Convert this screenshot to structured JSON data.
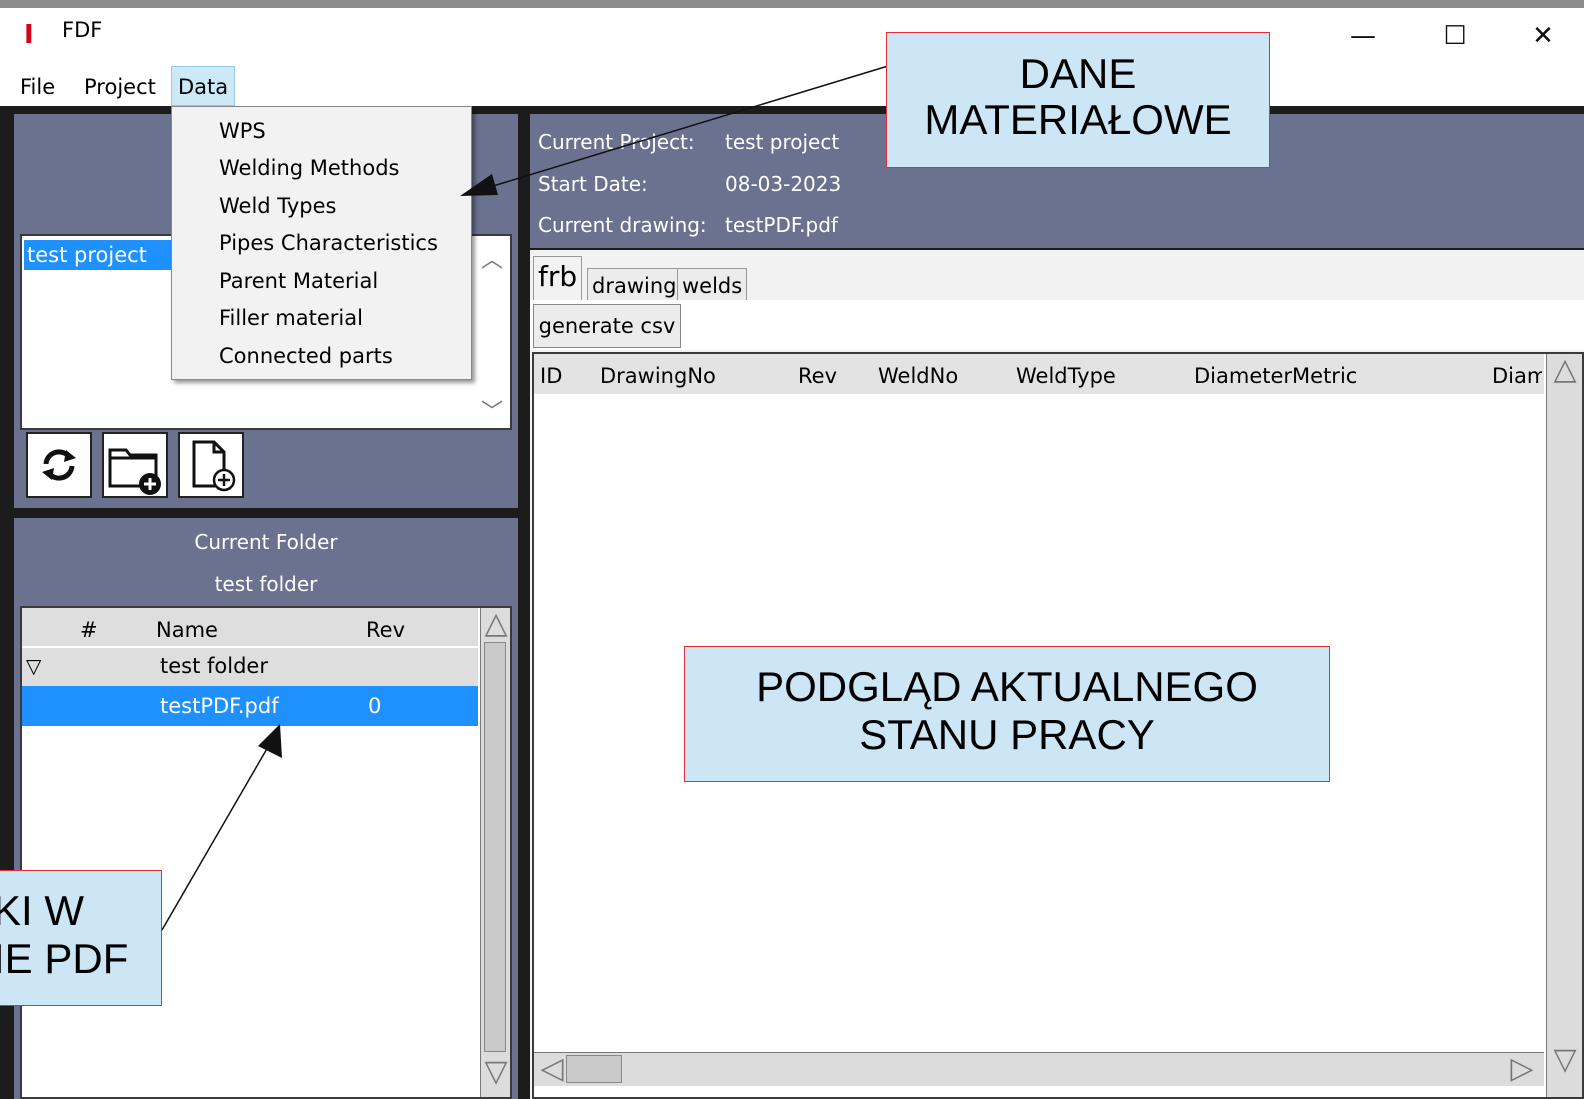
{
  "window": {
    "title": "FDF",
    "logo_glyph": "I",
    "minimize_glyph": "—",
    "maximize_glyph": "☐",
    "close_glyph": "✕"
  },
  "menu": {
    "items": [
      "File",
      "Project",
      "Data"
    ],
    "active": "Data"
  },
  "data_menu": {
    "items": [
      "WPS",
      "Welding Methods",
      "Weld Types",
      "Pipes Characteristics",
      "Parent Material",
      "Filler material",
      "Connected parts"
    ]
  },
  "projects": {
    "list": [
      "test project"
    ],
    "selected": "test project"
  },
  "toolbar": {
    "refresh_icon": "refresh-icon",
    "new_folder_icon": "folder-add-icon",
    "new_file_icon": "file-add-icon"
  },
  "folder_panel": {
    "label": "Current Folder",
    "name": "test folder",
    "columns": [
      "#",
      "Name",
      "Rev"
    ],
    "tree": [
      {
        "num": "",
        "name": "test folder",
        "rev": "",
        "expander": "▽"
      },
      {
        "num": "",
        "name": "testPDF.pdf",
        "rev": "0",
        "expander": ""
      }
    ]
  },
  "project_info": {
    "current_project_label": "Current Project:",
    "current_project": "test project",
    "start_date_label": "Start Date:",
    "start_date": "08-03-2023",
    "current_drawing_label": "Current drawing:",
    "current_drawing": "testPDF.pdf"
  },
  "tabs": [
    "frb",
    "drawing",
    "welds"
  ],
  "active_tab": "frb",
  "generate_button": "generate csv",
  "table": {
    "columns": [
      "ID",
      "DrawingNo",
      "Rev",
      "WeldNo",
      "WeldType",
      "DiameterMetric",
      "Diam"
    ]
  },
  "annotations": {
    "material": [
      "DANE",
      "MATERIAŁOWE"
    ],
    "preview": [
      "PODGLĄD AKTUALNEGO",
      "STANU PRACY"
    ],
    "pdf": [
      "KI W",
      "IE PDF"
    ]
  },
  "colors": {
    "panel_slate": "#6b7290",
    "selection": "#1e90ff",
    "annotation_fill": "#cde6f5",
    "annotation_border": "#e0303a"
  }
}
